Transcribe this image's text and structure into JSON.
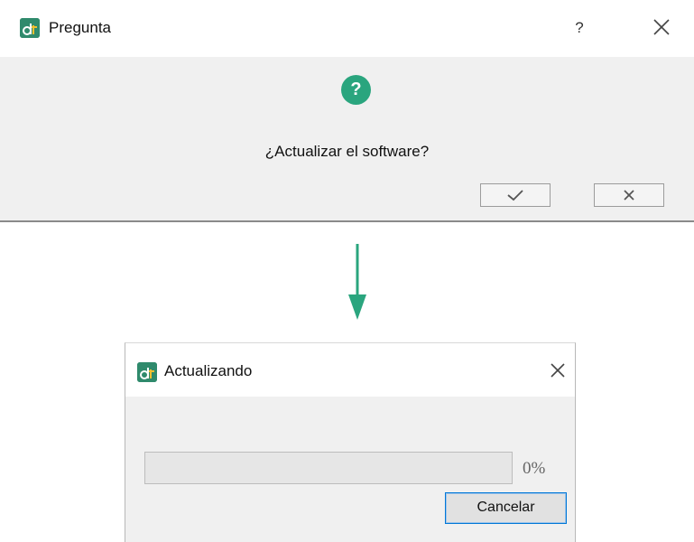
{
  "question_dialog": {
    "title": "Pregunta",
    "help_label": "?",
    "message": "¿Actualizar el software?",
    "confirm_icon": "check-icon",
    "reject_icon": "close-icon",
    "question_icon_glyph": "?"
  },
  "flow_arrow": {
    "color": "#2aa57e"
  },
  "progress_dialog": {
    "title": "Actualizando",
    "progress": 0,
    "percent_label": "0%",
    "cancel_label": "Cancelar"
  },
  "colors": {
    "accent": "#2aa57e",
    "app_icon": "#2f8a6c",
    "focus_border": "#0078d7"
  }
}
